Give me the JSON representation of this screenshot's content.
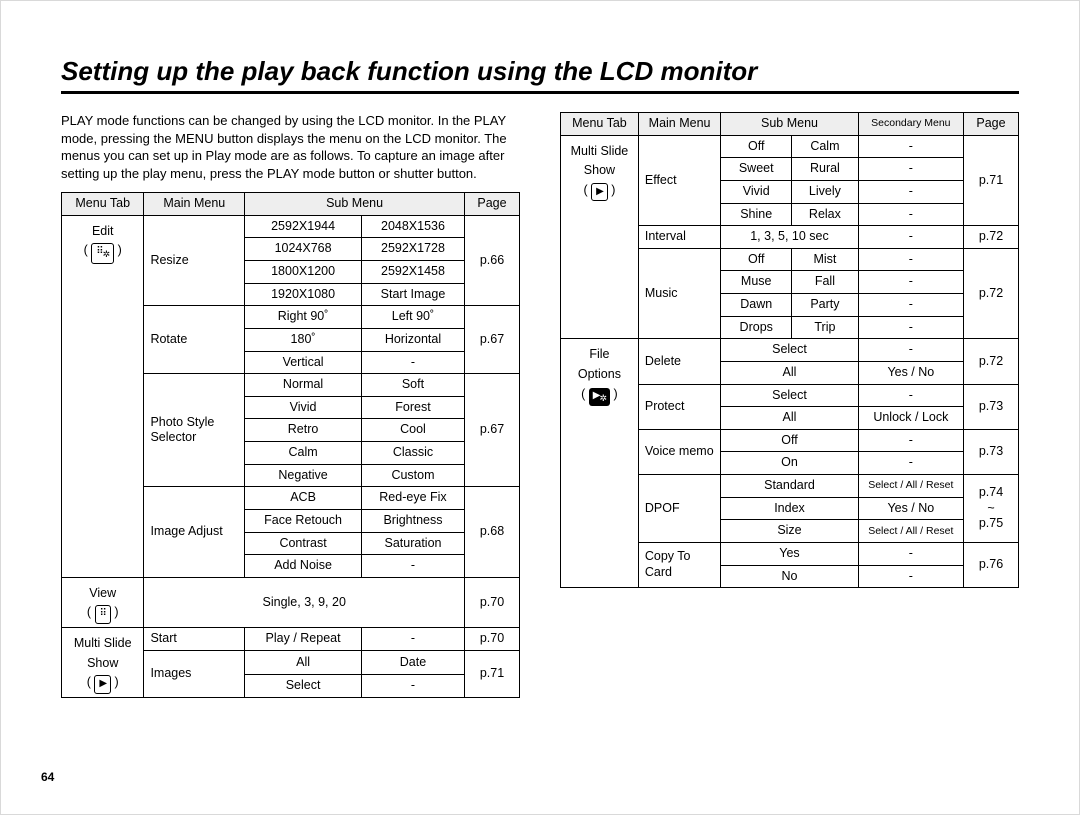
{
  "title": "Setting up the play back function using the LCD monitor",
  "intro": "PLAY mode functions can be changed by using the LCD monitor. In the PLAY mode, pressing the MENU button displays the menu on the LCD monitor. The menus you can set up in Play mode are as follows. To capture an image after setting up the play menu, press the PLAY mode button or shutter button.",
  "page_number": "64",
  "headers1": {
    "menutab": "Menu Tab",
    "main": "Main Menu",
    "sub": "Sub Menu",
    "page": "Page"
  },
  "headers2": {
    "menutab": "Menu Tab",
    "main": "Main Menu",
    "sub": "Sub Menu",
    "sec": "Secondary Menu",
    "page": "Page"
  },
  "t1": {
    "editTab": "Edit",
    "viewTab": "View",
    "mssTab1": "Multi Slide",
    "mssTab2": "Show",
    "resize": "Resize",
    "r11": "2592X1944",
    "r12": "2048X1536",
    "r21": "1024X768",
    "r22": "2592X1728",
    "r31": "1800X1200",
    "r32": "2592X1458",
    "r41": "1920X1080",
    "r42": "Start Image",
    "rotate": "Rotate",
    "ro11": "Right 90˚",
    "ro12": "Left 90˚",
    "ro21": "180˚",
    "ro22": "Horizontal",
    "ro31": "Vertical",
    "ro32": "-",
    "pss": "Photo Style Selector",
    "p11": "Normal",
    "p12": "Soft",
    "p21": "Vivid",
    "p22": "Forest",
    "p31": "Retro",
    "p32": "Cool",
    "p41": "Calm",
    "p42": "Classic",
    "p51": "Negative",
    "p52": "Custom",
    "ia": "Image Adjust",
    "i11": "ACB",
    "i12": "Red-eye Fix",
    "i21": "Face Retouch",
    "i22": "Brightness",
    "i31": "Contrast",
    "i32": "Saturation",
    "i41": "Add Noise",
    "i42": "-",
    "viewSub": "Single, 3, 9, 20",
    "start": "Start",
    "startSub": "Play / Repeat",
    "startDash": "-",
    "images": "Images",
    "im11": "All",
    "im12": "Date",
    "im21": "Select",
    "im22": "-",
    "pg66": "p.66",
    "pg67a": "p.67",
    "pg67b": "p.67",
    "pg68": "p.68",
    "pg70a": "p.70",
    "pg70b": "p.70",
    "pg71": "p.71"
  },
  "t2": {
    "mssTab1": "Multi Slide",
    "mssTab2": "Show",
    "foTab1": "File",
    "foTab2": "Options",
    "effect": "Effect",
    "e11": "Off",
    "e12": "Calm",
    "e21": "Sweet",
    "e22": "Rural",
    "e31": "Vivid",
    "e32": "Lively",
    "e41": "Shine",
    "e42": "Relax",
    "interval": "Interval",
    "intervalSub": "1, 3, 5, 10 sec",
    "intervalDash": "-",
    "music": "Music",
    "m11": "Off",
    "m12": "Mist",
    "m21": "Muse",
    "m22": "Fall",
    "m31": "Dawn",
    "m32": "Party",
    "m41": "Drops",
    "m42": "Trip",
    "delete": "Delete",
    "d11": "Select",
    "d12": "-",
    "d21": "All",
    "d22": "Yes / No",
    "protect": "Protect",
    "pr11": "Select",
    "pr12": "-",
    "pr21": "All",
    "pr22": "Unlock / Lock",
    "vmemo": "Voice memo",
    "v11": "Off",
    "v12": "-",
    "v21": "On",
    "v22": "-",
    "dpof": "DPOF",
    "dp11": "Standard",
    "dp12": "Select / All / Reset",
    "dp21": "Index",
    "dp22": "Yes / No",
    "dp31": "Size",
    "dp32": "Select / All / Reset",
    "copy": "Copy To Card",
    "c11": "Yes",
    "c12": "-",
    "c21": "No",
    "c22": "-",
    "dash": "-",
    "pg71": "p.71",
    "pg72a": "p.72",
    "pg72b": "p.72",
    "pg72c": "p.72",
    "pg73a": "p.73",
    "pg73b": "p.73",
    "pg7475": "p.74\n~\np.75",
    "pg76": "p.76"
  }
}
